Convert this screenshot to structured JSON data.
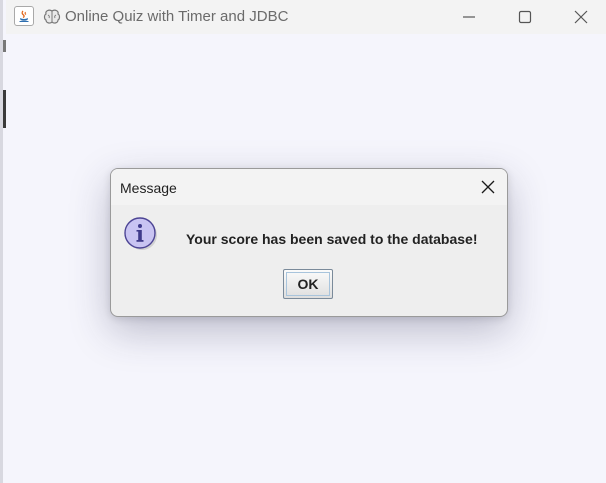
{
  "window": {
    "title": "Online Quiz with Timer and JDBC",
    "icons": {
      "app": "java-icon",
      "brand": "brain-icon"
    },
    "controls": [
      "minimize-icon",
      "maximize-icon",
      "close-icon"
    ]
  },
  "dialog": {
    "title": "Message",
    "message": "Your score has been saved to the database!",
    "ok_label": "OK",
    "icon": "information-icon",
    "close_icon": "close-icon"
  },
  "colors": {
    "background": "#f5f5fc",
    "dialog_background": "#eeeeee",
    "info_icon_fill": "#c9c4f2",
    "info_icon_border": "#4c4494"
  }
}
